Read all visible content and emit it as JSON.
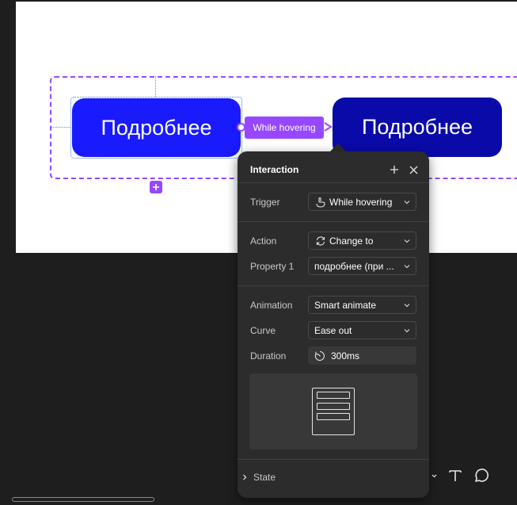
{
  "canvas": {
    "variants": [
      {
        "label": "Подробнее",
        "color": "#1a1aff"
      },
      {
        "label": "Подробнее",
        "color": "#0a0aa8"
      }
    ],
    "connection_label": "While hovering",
    "accent_color": "#9747ff"
  },
  "panel": {
    "title": "Interaction",
    "header_icons": [
      "plus-icon",
      "close-icon"
    ],
    "trigger": {
      "label": "Trigger",
      "value": "While hovering",
      "icon": "hover-hand-icon"
    },
    "action": {
      "label": "Action",
      "value": "Change to",
      "icon": "swap-arrows-icon"
    },
    "property": {
      "label": "Property 1",
      "value": "подробнее (при ..."
    },
    "animation": {
      "label": "Animation",
      "value": "Smart animate"
    },
    "curve": {
      "label": "Curve",
      "value": "Ease out"
    },
    "duration": {
      "label": "Duration",
      "value": "300ms",
      "icon": "timer-icon"
    },
    "state": {
      "label": "State"
    }
  },
  "toolbar": {
    "tools": [
      "shape-dropdown-icon",
      "text-tool-icon",
      "comment-tool-icon"
    ],
    "text_tool_glyph": "T"
  }
}
